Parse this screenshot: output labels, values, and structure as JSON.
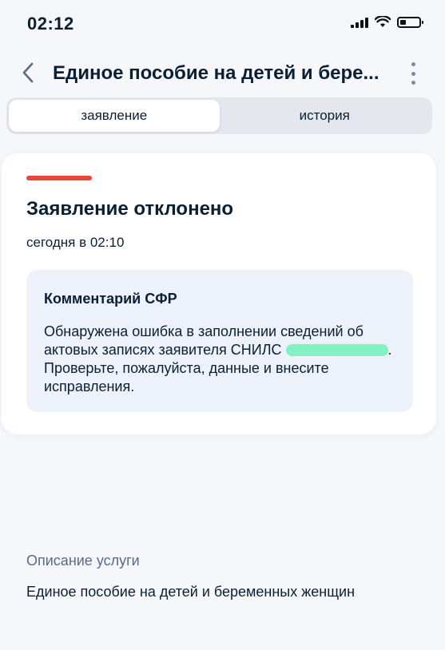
{
  "status_bar": {
    "time": "02:12"
  },
  "header": {
    "title": "Единое пособие на детей и бере..."
  },
  "tabs": [
    {
      "label": "заявление",
      "active": true
    },
    {
      "label": "история",
      "active": false
    }
  ],
  "card": {
    "accent_color": "#e8453c",
    "title": "Заявление отклонено",
    "date": "сегодня в 02:10",
    "comment": {
      "title": "Комментарий СФР",
      "text_before": "Обнаружена ошибка в заполнении сведений об актовых записях заявителя СНИЛС ",
      "text_after": ". Проверьте, пожалуйста, данные и внесите исправления."
    }
  },
  "service": {
    "label": "Описание услуги",
    "name": "Единое пособие на детей и беременных женщин"
  }
}
